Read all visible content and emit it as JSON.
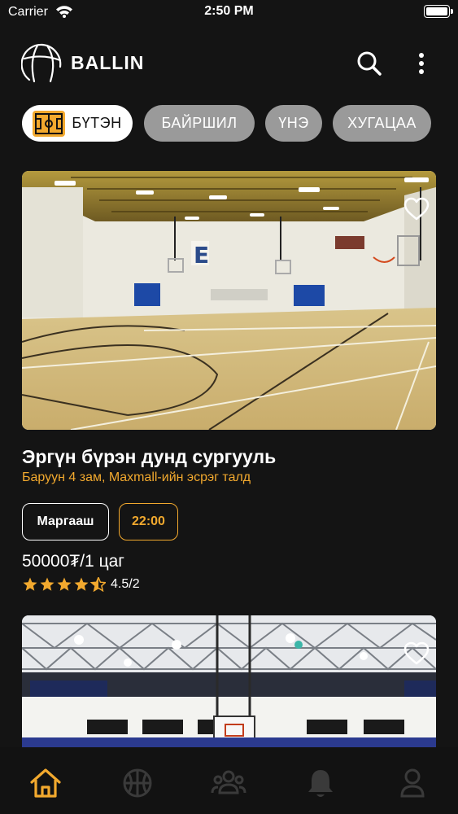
{
  "status_bar": {
    "carrier": "Carrier",
    "time": "2:50 PM"
  },
  "header": {
    "brand": "BALLIN",
    "icons": [
      "basketball-logo-icon",
      "search-icon",
      "more-vertical-icon"
    ]
  },
  "filters": [
    {
      "label": "БҮТЭН",
      "active": true,
      "icon": "court-icon"
    },
    {
      "label": "БАЙРШИЛ",
      "active": false
    },
    {
      "label": "ҮНЭ",
      "active": false
    },
    {
      "label": "ХУГАЦАА",
      "active": false
    }
  ],
  "cards": [
    {
      "title": "Эргүн бүрэн дунд сургууль",
      "address": "Баруун 4 зам, Maxmall-ийн эсрэг талд",
      "day": "Маргааш",
      "time": "22:00",
      "price": "50000₮/1 цаг",
      "rating": "4.5/2",
      "stars": 4.5
    }
  ],
  "nav": {
    "items": [
      {
        "icon": "home-icon",
        "active": true
      },
      {
        "icon": "basketball-icon",
        "active": false
      },
      {
        "icon": "group-icon",
        "active": false
      },
      {
        "icon": "bell-icon",
        "active": false
      },
      {
        "icon": "profile-icon",
        "active": false
      }
    ]
  },
  "colors": {
    "background": "#141414",
    "accent": "#f2a92e",
    "inactive_chip": "#9a9a9a",
    "inactive_icon": "#3a3a3a"
  }
}
